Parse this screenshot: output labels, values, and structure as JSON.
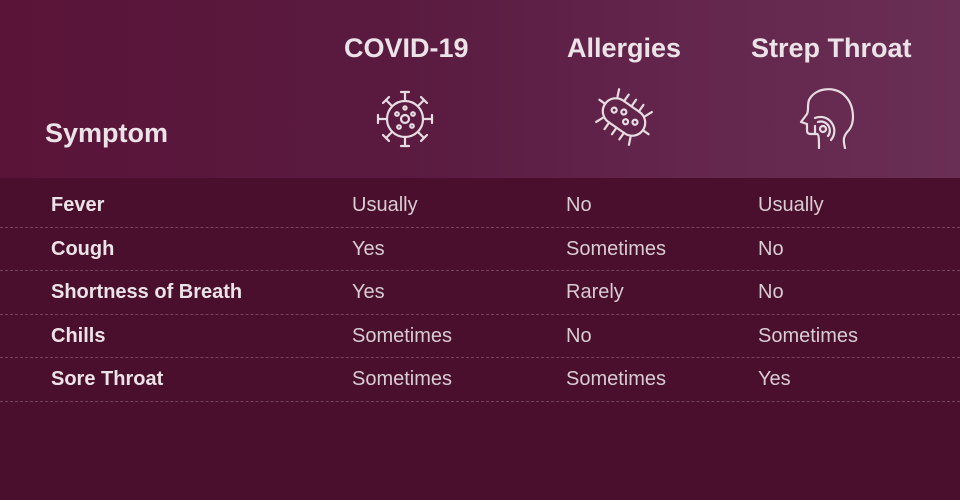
{
  "header": {
    "symptom_label": "Symptom",
    "columns": [
      {
        "label": "COVID-19",
        "icon": "virus-icon"
      },
      {
        "label": "Allergies",
        "icon": "bacteria-icon"
      },
      {
        "label": "Strep Throat",
        "icon": "sore-throat-head-icon"
      }
    ]
  },
  "rows": [
    {
      "symptom": "Fever",
      "values": [
        "Usually",
        "No",
        "Usually"
      ]
    },
    {
      "symptom": "Cough",
      "values": [
        "Yes",
        "Sometimes",
        "No"
      ]
    },
    {
      "symptom": "Shortness of Breath",
      "values": [
        "Yes",
        "Rarely",
        "No"
      ]
    },
    {
      "symptom": "Chills",
      "values": [
        "Sometimes",
        "No",
        "Sometimes"
      ]
    },
    {
      "symptom": "Sore Throat",
      "values": [
        "Sometimes",
        "Sometimes",
        "Yes"
      ]
    }
  ],
  "colors": {
    "background": "#4a0f2d",
    "header_gradient_start": "#5a1438",
    "header_gradient_end": "#6a2f55",
    "text": "#ece3e8"
  }
}
